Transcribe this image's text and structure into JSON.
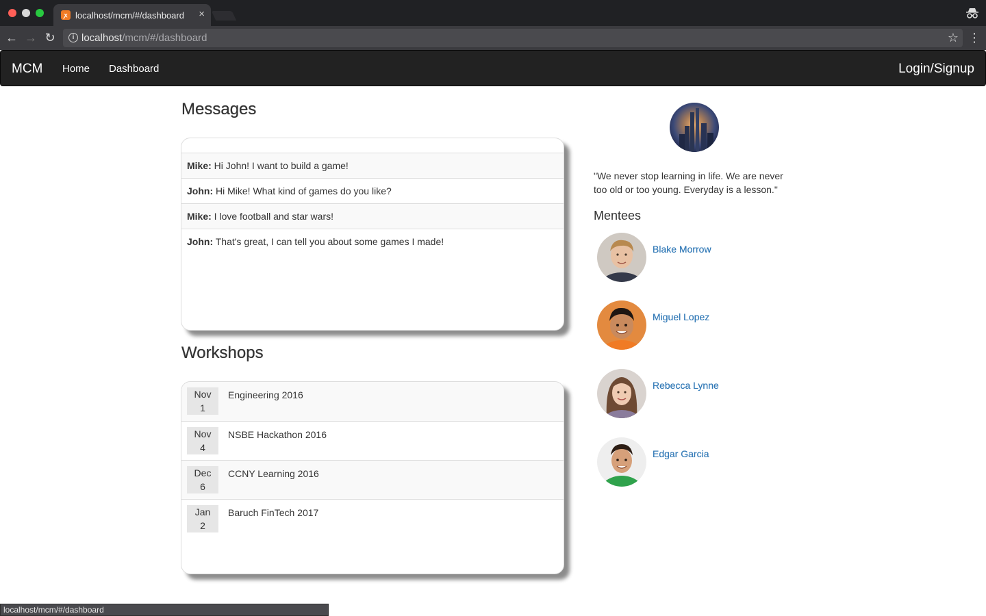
{
  "browser": {
    "tab_title": "localhost/mcm/#/dashboard",
    "tab_favicon": "xampp-favicon",
    "url_host": "localhost",
    "url_path": "/mcm/#/dashboard",
    "status_url": "localhost/mcm/#/dashboard"
  },
  "navbar": {
    "brand": "MCM",
    "links": [
      "Home",
      "Dashboard"
    ],
    "login": "Login/Signup"
  },
  "messages": {
    "title": "Messages",
    "items": [
      {
        "sender": "Mike:",
        "text": " Hi John! I want to build a game!"
      },
      {
        "sender": "John:",
        "text": " Hi Mike! What kind of games do you like?"
      },
      {
        "sender": "Mike:",
        "text": " I love football and star wars!"
      },
      {
        "sender": "John:",
        "text": " That's great, I can tell you about some games I made!"
      }
    ]
  },
  "workshops": {
    "title": "Workshops",
    "items": [
      {
        "month": "Nov",
        "day": "1",
        "name": "Engineering 2016"
      },
      {
        "month": "Nov",
        "day": "4",
        "name": "NSBE Hackathon 2016"
      },
      {
        "month": "Dec",
        "day": "6",
        "name": "CCNY Learning 2016"
      },
      {
        "month": "Jan",
        "day": "2",
        "name": "Baruch FinTech 2017"
      }
    ]
  },
  "profile": {
    "quote": "\"We never stop learning in life. We are never too old or too young. Everyday is a lesson.\""
  },
  "mentees": {
    "title": "Mentees",
    "items": [
      {
        "name": "Blake Morrow"
      },
      {
        "name": "Miguel Lopez"
      },
      {
        "name": "Rebecca Lynne"
      },
      {
        "name": "Edgar Garcia"
      }
    ]
  },
  "colors": {
    "navbar_bg": "#222222",
    "link": "#337ab7",
    "row_alt": "#f9f9f9"
  }
}
